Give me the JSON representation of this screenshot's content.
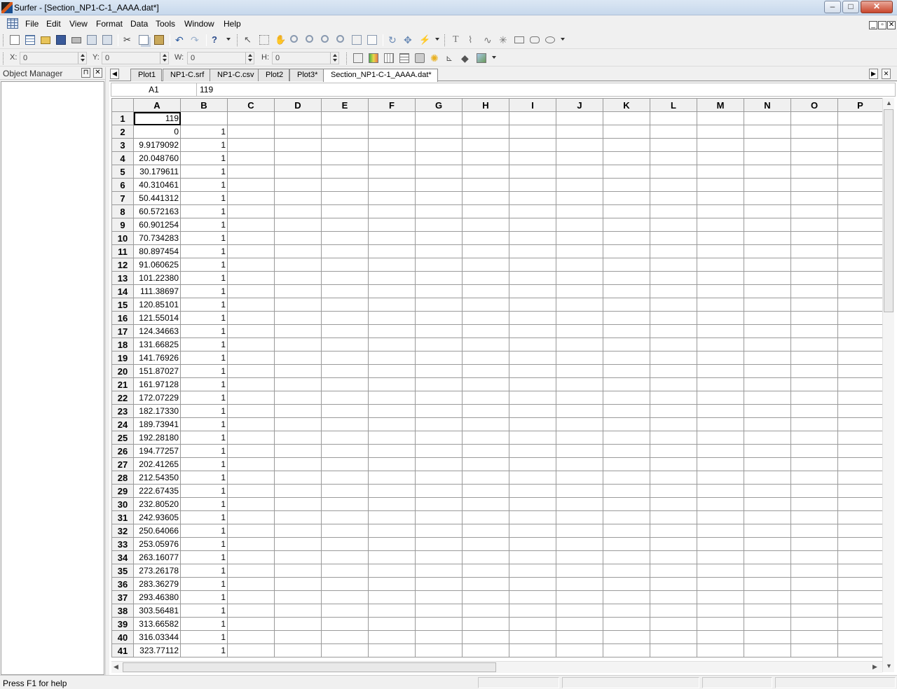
{
  "window": {
    "title": "Surfer - [Section_NP1-C-1_AAAA.dat*]",
    "minimize": "–",
    "maximize": "□",
    "close": "✕"
  },
  "menubar": {
    "items": [
      "File",
      "Edit",
      "View",
      "Format",
      "Data",
      "Tools",
      "Window",
      "Help"
    ],
    "mdi": [
      "_",
      "▫",
      "✕"
    ]
  },
  "coords": {
    "x_label": "X:",
    "x_value": "0",
    "y_label": "Y:",
    "y_value": "0",
    "w_label": "W:",
    "w_value": "0",
    "h_label": "H:",
    "h_value": "0"
  },
  "object_manager": {
    "title": "Object Manager",
    "pin": "📌",
    "close": "✕"
  },
  "tabs": {
    "items": [
      "Plot1",
      "NP1-C.srf",
      "NP1-C.csv",
      "Plot2",
      "Plot3*",
      "Section_NP1-C-1_AAAA.dat*"
    ],
    "active_index": 5,
    "left_nav": "◀",
    "right_nav": "▶",
    "close": "✕"
  },
  "formula_bar": {
    "cell_ref": "A1",
    "value": "119"
  },
  "worksheet": {
    "columns": [
      "A",
      "B",
      "C",
      "D",
      "E",
      "F",
      "G",
      "H",
      "I",
      "J",
      "K",
      "L",
      "M",
      "N",
      "O",
      "P"
    ],
    "rows": [
      [
        "119",
        ""
      ],
      [
        "0",
        "1"
      ],
      [
        "9.9179092",
        "1"
      ],
      [
        "20.048760",
        "1"
      ],
      [
        "30.179611",
        "1"
      ],
      [
        "40.310461",
        "1"
      ],
      [
        "50.441312",
        "1"
      ],
      [
        "60.572163",
        "1"
      ],
      [
        "60.901254",
        "1"
      ],
      [
        "70.734283",
        "1"
      ],
      [
        "80.897454",
        "1"
      ],
      [
        "91.060625",
        "1"
      ],
      [
        "101.22380",
        "1"
      ],
      [
        "111.38697",
        "1"
      ],
      [
        "120.85101",
        "1"
      ],
      [
        "121.55014",
        "1"
      ],
      [
        "124.34663",
        "1"
      ],
      [
        "131.66825",
        "1"
      ],
      [
        "141.76926",
        "1"
      ],
      [
        "151.87027",
        "1"
      ],
      [
        "161.97128",
        "1"
      ],
      [
        "172.07229",
        "1"
      ],
      [
        "182.17330",
        "1"
      ],
      [
        "189.73941",
        "1"
      ],
      [
        "192.28180",
        "1"
      ],
      [
        "194.77257",
        "1"
      ],
      [
        "202.41265",
        "1"
      ],
      [
        "212.54350",
        "1"
      ],
      [
        "222.67435",
        "1"
      ],
      [
        "232.80520",
        "1"
      ],
      [
        "242.93605",
        "1"
      ],
      [
        "250.64066",
        "1"
      ],
      [
        "253.05976",
        "1"
      ],
      [
        "263.16077",
        "1"
      ],
      [
        "273.26178",
        "1"
      ],
      [
        "283.36279",
        "1"
      ],
      [
        "293.46380",
        "1"
      ],
      [
        "303.56481",
        "1"
      ],
      [
        "313.66582",
        "1"
      ],
      [
        "316.03344",
        "1"
      ],
      [
        "323.77112",
        "1"
      ]
    ]
  },
  "statusbar": {
    "text": "Press F1 for help"
  },
  "icons": {
    "toolbar1": [
      "new-worksheet-icon",
      "new-plot-icon",
      "open-icon",
      "save-icon",
      "print-icon",
      "export-icon",
      "import-icon",
      "cut-icon",
      "copy-icon",
      "paste-icon",
      "undo-icon",
      "redo-icon",
      "help-icon",
      "select-icon",
      "block-select-icon",
      "pan-icon",
      "zoom-in-icon",
      "zoom-in-2-icon",
      "zoom-out-icon",
      "zoom-rect-icon",
      "fit-window-icon",
      "page-icon",
      "rotate-icon",
      "trackball-icon",
      "digitize-icon",
      "text-icon",
      "polyline-icon",
      "spline-icon",
      "symbol-icon",
      "rectangle-icon",
      "rounded-rectangle-icon",
      "ellipse-icon"
    ],
    "toolbar2": [
      "map-icon",
      "color-icon",
      "grid-icon",
      "legend-icon",
      "camera-icon",
      "light-icon",
      "axis-icon",
      "3d-icon",
      "image-icon"
    ]
  }
}
